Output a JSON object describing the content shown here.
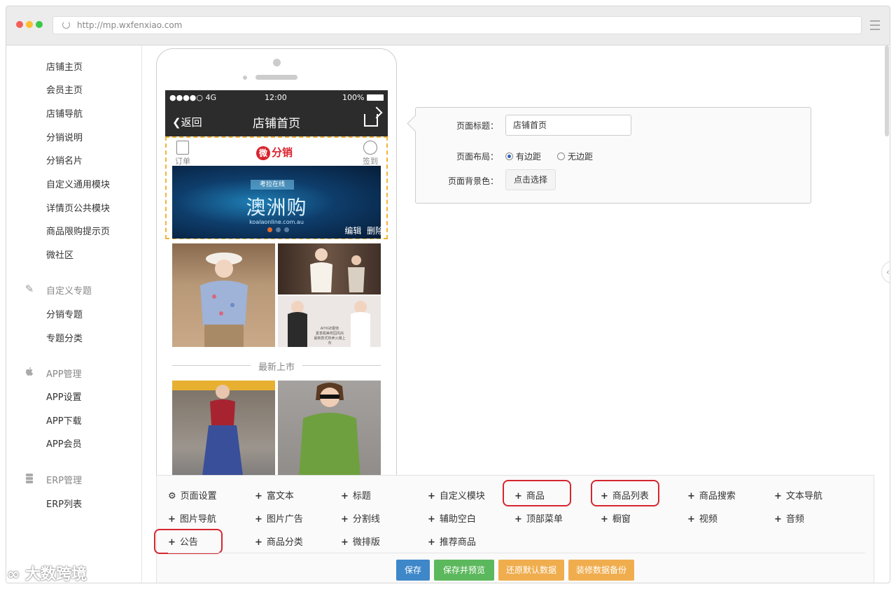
{
  "browser": {
    "url": "http://mp.wxfenxiao.com"
  },
  "sidebar": {
    "items": [
      "店铺主页",
      "会员主页",
      "店铺导航",
      "分销说明",
      "分销名片",
      "自定义通用模块",
      "详情页公共模块",
      "商品限购提示页",
      "微社区"
    ],
    "group1": {
      "title": "自定义专题",
      "icon": "pencil-icon",
      "items": [
        "分销专题",
        "专题分类"
      ]
    },
    "group2": {
      "title": "APP管理",
      "icon": "apple-icon",
      "items": [
        "APP设置",
        "APP下载",
        "APP会员"
      ]
    },
    "group3": {
      "title": "ERP管理",
      "icon": "database-icon",
      "items": [
        "ERP列表"
      ]
    }
  },
  "phone": {
    "status": {
      "carrier": "●●●●○ 4G",
      "time": "12:00",
      "battery": "100%"
    },
    "nav": {
      "back": "返回",
      "title": "店铺首页"
    },
    "header": {
      "order": "订单",
      "checkin": "签到",
      "logo_wei": "微",
      "logo_text": "分销"
    },
    "banner": {
      "sub": "考拉在线",
      "main": "澳洲购",
      "site": "koalaonline.com.au",
      "edit": "编辑",
      "delete": "删除"
    },
    "ad_text": {
      "line1": "AIYIGE服饰",
      "line2": "夏季甜美校园风尚",
      "line3": "最新款式热卖火爆上市"
    },
    "section": "最新上市"
  },
  "panel": {
    "title_label": "页面标题：",
    "title_value": "店铺首页",
    "layout_label": "页面布局：",
    "layout_opt1": "有边距",
    "layout_opt2": "无边距",
    "bg_label": "页面背景色：",
    "bg_button": "点击选择"
  },
  "toolbar": {
    "row1": [
      "页面设置",
      "富文本",
      "标题",
      "自定义模块",
      "商品",
      "商品列表",
      "商品搜索",
      "文本导航"
    ],
    "row2": [
      "图片导航",
      "图片广告",
      "分割线",
      "辅助空白",
      "顶部菜单",
      "橱窗",
      "视频",
      "音频"
    ],
    "row3": [
      "公告",
      "商品分类",
      "微排版",
      "推荐商品"
    ],
    "actions": {
      "save": "保存",
      "save_preview": "保存并预览",
      "restore": "还原默认数据",
      "backup": "装修数据备份"
    }
  },
  "watermark": "大数跨境",
  "colors": {
    "highlight": "#d5262f",
    "save": "#3e87c9",
    "preview": "#5cb85c",
    "warn": "#f0ad4e"
  }
}
